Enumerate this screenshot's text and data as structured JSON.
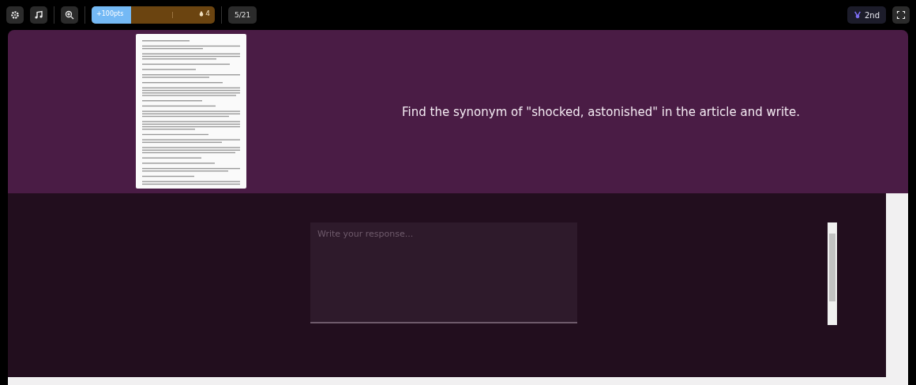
{
  "toolbar": {
    "progress": {
      "points": "+100pts",
      "level": 0.32,
      "drops": "4"
    },
    "counter": "5/21",
    "rank": "2nd"
  },
  "question": {
    "prompt": "Find the synonym of \"shocked, astonished\" in the article and write."
  },
  "answer": {
    "placeholder": "Write your response..."
  }
}
